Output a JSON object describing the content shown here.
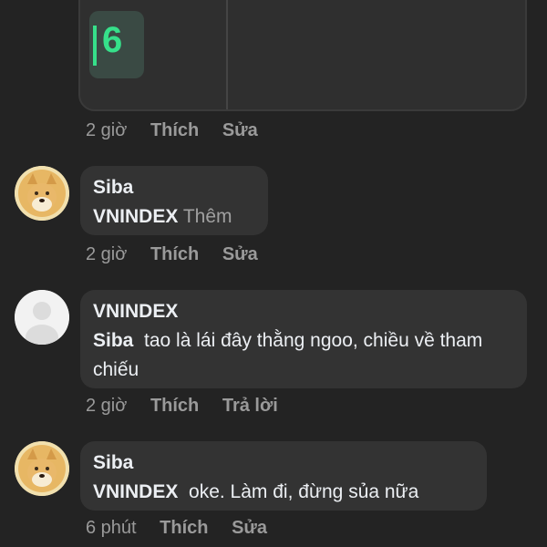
{
  "top_card": {
    "thumbnail_number": "6"
  },
  "comments": [
    {
      "meta": {
        "time": "2 giờ",
        "like": "Thích",
        "action": "Sửa"
      }
    },
    {
      "author": "Siba",
      "mention": "VNINDEX",
      "text": "",
      "more": "Thêm",
      "meta": {
        "time": "2 giờ",
        "like": "Thích",
        "action": "Sửa"
      }
    },
    {
      "author": "VNINDEX",
      "mention": "Siba",
      "text": "tao là lái đây thằng ngoo, chiều về tham chiếu",
      "meta": {
        "time": "2 giờ",
        "like": "Thích",
        "action": "Trả lời"
      }
    },
    {
      "author": "Siba",
      "mention": "VNINDEX",
      "text": "oke. Làm đi, đừng sủa nữa",
      "meta": {
        "time": "6 phút",
        "like": "Thích",
        "action": "Sửa"
      }
    }
  ]
}
